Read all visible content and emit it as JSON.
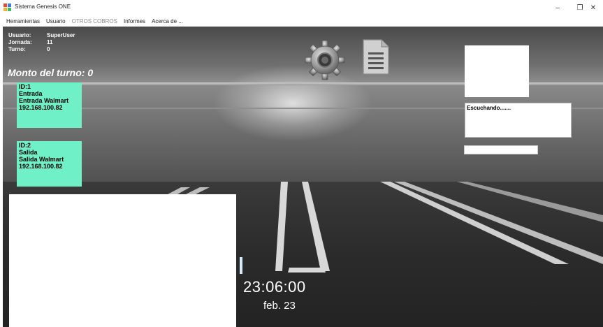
{
  "window": {
    "title": "Sistema Genesis ONE",
    "icons": {
      "app": "app-icon",
      "minimize": "minimize-icon",
      "maximize": "restore-icon",
      "close": "close-icon"
    },
    "minimize_glyph": "–",
    "maximize_glyph": "❐",
    "close_glyph": "✕"
  },
  "menu": {
    "items": [
      {
        "label": "Herramientas",
        "enabled": true
      },
      {
        "label": "Usuario",
        "enabled": true
      },
      {
        "label": "OTROS COBROS",
        "enabled": false
      },
      {
        "label": "Informes",
        "enabled": true
      },
      {
        "label": "Acerca de ...",
        "enabled": true
      }
    ]
  },
  "session": {
    "user_label": "Usuario:",
    "user_value": "SuperUser",
    "jornada_label": "Jornada:",
    "jornada_value": "11",
    "turno_label": "Turno:",
    "turno_value": "0"
  },
  "monto": {
    "label": "Monto del turno:",
    "value": "0"
  },
  "devices": [
    {
      "id": "ID:1",
      "type": "Entrada",
      "name": "Entrada Walmart",
      "ip": "192.168.100.82"
    },
    {
      "id": "ID:2",
      "type": "Salida",
      "name": "Salida Walmart",
      "ip": "192.168.100.82"
    }
  ],
  "toolbar": {
    "settings_icon": "gear-icon",
    "report_icon": "document-icon"
  },
  "status": {
    "listening_text": "Escuchando......."
  },
  "clock": {
    "time": "23:06:00",
    "date": "feb. 23"
  },
  "colors": {
    "device_card": "#6ff0c7",
    "text_light": "#ffffff",
    "menu_disabled": "#8a8a8a"
  }
}
